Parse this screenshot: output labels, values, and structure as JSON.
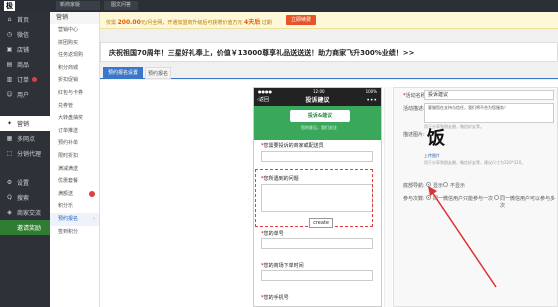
{
  "topbar": {
    "logo": "极",
    "store": "新商家版",
    "tab2": "图文问答"
  },
  "side1": {
    "items": [
      {
        "icon": "⌂",
        "label": "首页"
      },
      {
        "icon": "◷",
        "label": "微信"
      },
      {
        "icon": "▣",
        "label": "店铺"
      },
      {
        "icon": "▤",
        "label": "商品"
      },
      {
        "icon": "▥",
        "label": "订单"
      },
      {
        "icon": "☺",
        "label": "用户"
      },
      {
        "icon": "✦",
        "label": "营销"
      },
      {
        "icon": "▦",
        "label": "多网点"
      },
      {
        "icon": "⬚",
        "label": "分销代理"
      },
      {
        "icon": "⚙",
        "label": "设置"
      },
      {
        "icon": "Q",
        "label": "搜索"
      },
      {
        "icon": "◈",
        "label": "商家交流"
      },
      {
        "icon": "",
        "label": "邀请奖励"
      }
    ]
  },
  "side2": {
    "head": "营销",
    "items": [
      "营销中心",
      "拼团购买",
      "任务返现购",
      "积分商城",
      "折扣促销",
      "红包与卡券",
      "兑券管",
      "大转盘抽奖",
      "订单推送",
      "预约补单",
      "限时折扣",
      "满减满送",
      "优惠套餐",
      "满额送",
      "积分乐",
      "预约报名",
      "签到积分"
    ]
  },
  "notice": {
    "prefix": "仅需 ",
    "amount": "200.00",
    "middle": "元/月全网，开通加盟商升级后可获赠价值万元 ",
    "days": "4天后",
    "suffix": " 过期",
    "button": "立即续费"
  },
  "banner": {
    "title": "庆祝祖国70周年！三星好礼奉上，价值￥13000尊享礼品送送送！助力商家飞升300%业绩！>>"
  },
  "tabs": {
    "tab1": "预约报名设置",
    "tab2": "预约报名"
  },
  "phone": {
    "time": "12:00",
    "signal": "100%",
    "back": "返回",
    "title": "投诉建议",
    "more": "•••",
    "banner_title": "投诉&建议",
    "banner_sub": "您的意见，我们关注",
    "q1": "您需要投诉的商家或配送员",
    "q2": "您所遇到的问题",
    "q3": "您的单号",
    "q4": "您的商场下单时间",
    "q5": "您的手机号",
    "tooltip": "create"
  },
  "form": {
    "l_title": "活动名称:",
    "v_title": "投诉建议",
    "l_desc": "活动描述:",
    "v_desc": "客服您在支持与信任，我们将不合为您服务！",
    "hint_desc": "用于分享到朋友圈，微信好友等。",
    "l_img": "描述图片:",
    "img_glyph": "饭",
    "upload": "上传图片",
    "hint_img": "用于分享到朋友圈，微信好友等，建议尺寸为320*320。",
    "l_nav": "底部导航:",
    "nav_on": "显示",
    "nav_off": "不显示",
    "l_times": "参与次数:",
    "times_once": "同一微信用户只能参与一次",
    "times_multi": "同一微信用户可以参与多次"
  }
}
